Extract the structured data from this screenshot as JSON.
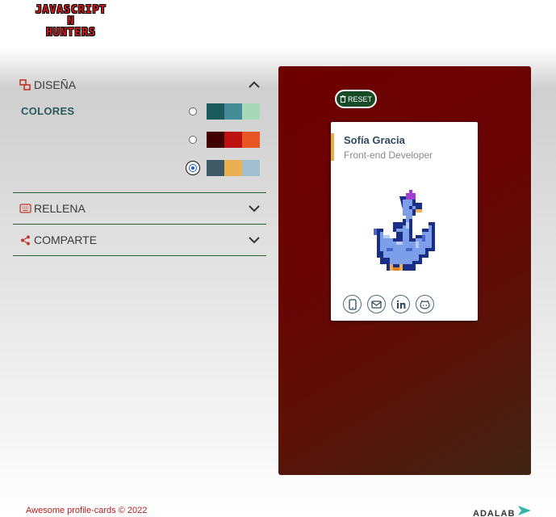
{
  "header": {
    "logo_line1": "JAVASCRIPT",
    "logo_line2": "N",
    "logo_line3": "HUNTERS"
  },
  "sections": {
    "design": {
      "label": "DISEÑA",
      "expanded": true
    },
    "fill": {
      "label": "RELLENA",
      "expanded": false
    },
    "share": {
      "label": "COMPARTE",
      "expanded": false
    }
  },
  "colors": {
    "label": "COLORES",
    "selected_palette": 3,
    "palettes": [
      [
        "#1b5b5d",
        "#438b97",
        "#a6d9b9"
      ],
      [
        "#420101",
        "#bd1010",
        "#e95626"
      ],
      [
        "#3e5b65",
        "#eab052",
        "#a0c0cf"
      ]
    ]
  },
  "preview": {
    "reset_label": "RESET",
    "card_name": "Sofía Gracia",
    "card_job": "Front-end Developer",
    "accent_color": "#e2b04b"
  },
  "socials": [
    "phone-icon",
    "email-icon",
    "linkedin-icon",
    "github-icon"
  ],
  "footer": {
    "copyright": "Awesome profile-cards © 2022",
    "brand": "ADALAB"
  }
}
